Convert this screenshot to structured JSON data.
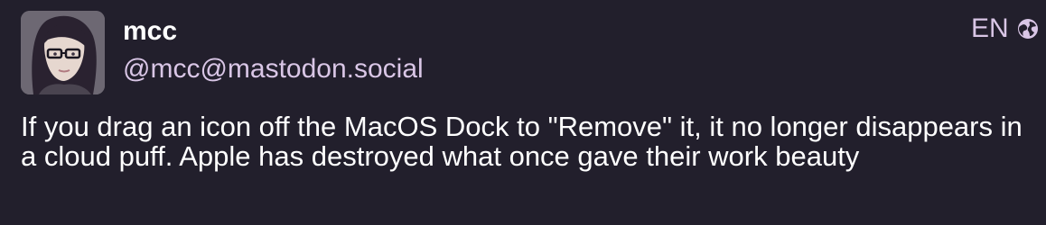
{
  "post": {
    "display_name": "mcc",
    "handle": "@mcc@mastodon.social",
    "language": "EN",
    "visibility_icon": "globe-icon",
    "avatar": "avatar-illustration",
    "content": "If you drag an icon off the MacOS Dock to \"Remove\" it, it no longer disappears in a cloud puff. Apple has destroyed what once gave their work beauty"
  },
  "colors": {
    "background": "#221f2c",
    "text": "#ffffff",
    "secondary_text": "#d9c6e6"
  }
}
